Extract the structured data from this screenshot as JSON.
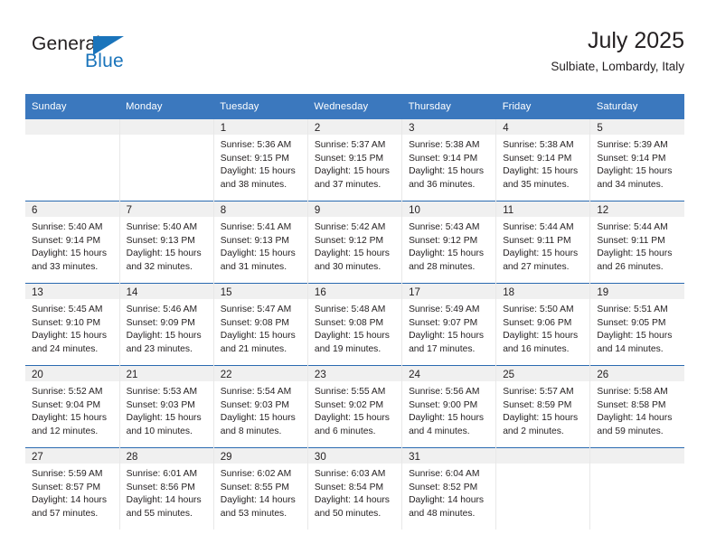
{
  "brand": {
    "word_top": "General",
    "word_bottom": "Blue",
    "accent_color": "#1a74bb"
  },
  "header": {
    "title": "July 2025",
    "subtitle": "Sulbiate, Lombardy, Italy"
  },
  "theme": {
    "header_bg": "#3b78be",
    "header_text": "#ffffff",
    "daynum_band_bg": "#f0f0f0",
    "row_divider": "#2a6ab0",
    "text": "#231f20"
  },
  "weekday_headers": [
    "Sunday",
    "Monday",
    "Tuesday",
    "Wednesday",
    "Thursday",
    "Friday",
    "Saturday"
  ],
  "weeks": [
    [
      {
        "day": "",
        "lines": []
      },
      {
        "day": "",
        "lines": []
      },
      {
        "day": "1",
        "lines": [
          "Sunrise: 5:36 AM",
          "Sunset: 9:15 PM",
          "Daylight: 15 hours",
          "and 38 minutes."
        ]
      },
      {
        "day": "2",
        "lines": [
          "Sunrise: 5:37 AM",
          "Sunset: 9:15 PM",
          "Daylight: 15 hours",
          "and 37 minutes."
        ]
      },
      {
        "day": "3",
        "lines": [
          "Sunrise: 5:38 AM",
          "Sunset: 9:14 PM",
          "Daylight: 15 hours",
          "and 36 minutes."
        ]
      },
      {
        "day": "4",
        "lines": [
          "Sunrise: 5:38 AM",
          "Sunset: 9:14 PM",
          "Daylight: 15 hours",
          "and 35 minutes."
        ]
      },
      {
        "day": "5",
        "lines": [
          "Sunrise: 5:39 AM",
          "Sunset: 9:14 PM",
          "Daylight: 15 hours",
          "and 34 minutes."
        ]
      }
    ],
    [
      {
        "day": "6",
        "lines": [
          "Sunrise: 5:40 AM",
          "Sunset: 9:14 PM",
          "Daylight: 15 hours",
          "and 33 minutes."
        ]
      },
      {
        "day": "7",
        "lines": [
          "Sunrise: 5:40 AM",
          "Sunset: 9:13 PM",
          "Daylight: 15 hours",
          "and 32 minutes."
        ]
      },
      {
        "day": "8",
        "lines": [
          "Sunrise: 5:41 AM",
          "Sunset: 9:13 PM",
          "Daylight: 15 hours",
          "and 31 minutes."
        ]
      },
      {
        "day": "9",
        "lines": [
          "Sunrise: 5:42 AM",
          "Sunset: 9:12 PM",
          "Daylight: 15 hours",
          "and 30 minutes."
        ]
      },
      {
        "day": "10",
        "lines": [
          "Sunrise: 5:43 AM",
          "Sunset: 9:12 PM",
          "Daylight: 15 hours",
          "and 28 minutes."
        ]
      },
      {
        "day": "11",
        "lines": [
          "Sunrise: 5:44 AM",
          "Sunset: 9:11 PM",
          "Daylight: 15 hours",
          "and 27 minutes."
        ]
      },
      {
        "day": "12",
        "lines": [
          "Sunrise: 5:44 AM",
          "Sunset: 9:11 PM",
          "Daylight: 15 hours",
          "and 26 minutes."
        ]
      }
    ],
    [
      {
        "day": "13",
        "lines": [
          "Sunrise: 5:45 AM",
          "Sunset: 9:10 PM",
          "Daylight: 15 hours",
          "and 24 minutes."
        ]
      },
      {
        "day": "14",
        "lines": [
          "Sunrise: 5:46 AM",
          "Sunset: 9:09 PM",
          "Daylight: 15 hours",
          "and 23 minutes."
        ]
      },
      {
        "day": "15",
        "lines": [
          "Sunrise: 5:47 AM",
          "Sunset: 9:08 PM",
          "Daylight: 15 hours",
          "and 21 minutes."
        ]
      },
      {
        "day": "16",
        "lines": [
          "Sunrise: 5:48 AM",
          "Sunset: 9:08 PM",
          "Daylight: 15 hours",
          "and 19 minutes."
        ]
      },
      {
        "day": "17",
        "lines": [
          "Sunrise: 5:49 AM",
          "Sunset: 9:07 PM",
          "Daylight: 15 hours",
          "and 17 minutes."
        ]
      },
      {
        "day": "18",
        "lines": [
          "Sunrise: 5:50 AM",
          "Sunset: 9:06 PM",
          "Daylight: 15 hours",
          "and 16 minutes."
        ]
      },
      {
        "day": "19",
        "lines": [
          "Sunrise: 5:51 AM",
          "Sunset: 9:05 PM",
          "Daylight: 15 hours",
          "and 14 minutes."
        ]
      }
    ],
    [
      {
        "day": "20",
        "lines": [
          "Sunrise: 5:52 AM",
          "Sunset: 9:04 PM",
          "Daylight: 15 hours",
          "and 12 minutes."
        ]
      },
      {
        "day": "21",
        "lines": [
          "Sunrise: 5:53 AM",
          "Sunset: 9:03 PM",
          "Daylight: 15 hours",
          "and 10 minutes."
        ]
      },
      {
        "day": "22",
        "lines": [
          "Sunrise: 5:54 AM",
          "Sunset: 9:03 PM",
          "Daylight: 15 hours",
          "and 8 minutes."
        ]
      },
      {
        "day": "23",
        "lines": [
          "Sunrise: 5:55 AM",
          "Sunset: 9:02 PM",
          "Daylight: 15 hours",
          "and 6 minutes."
        ]
      },
      {
        "day": "24",
        "lines": [
          "Sunrise: 5:56 AM",
          "Sunset: 9:00 PM",
          "Daylight: 15 hours",
          "and 4 minutes."
        ]
      },
      {
        "day": "25",
        "lines": [
          "Sunrise: 5:57 AM",
          "Sunset: 8:59 PM",
          "Daylight: 15 hours",
          "and 2 minutes."
        ]
      },
      {
        "day": "26",
        "lines": [
          "Sunrise: 5:58 AM",
          "Sunset: 8:58 PM",
          "Daylight: 14 hours",
          "and 59 minutes."
        ]
      }
    ],
    [
      {
        "day": "27",
        "lines": [
          "Sunrise: 5:59 AM",
          "Sunset: 8:57 PM",
          "Daylight: 14 hours",
          "and 57 minutes."
        ]
      },
      {
        "day": "28",
        "lines": [
          "Sunrise: 6:01 AM",
          "Sunset: 8:56 PM",
          "Daylight: 14 hours",
          "and 55 minutes."
        ]
      },
      {
        "day": "29",
        "lines": [
          "Sunrise: 6:02 AM",
          "Sunset: 8:55 PM",
          "Daylight: 14 hours",
          "and 53 minutes."
        ]
      },
      {
        "day": "30",
        "lines": [
          "Sunrise: 6:03 AM",
          "Sunset: 8:54 PM",
          "Daylight: 14 hours",
          "and 50 minutes."
        ]
      },
      {
        "day": "31",
        "lines": [
          "Sunrise: 6:04 AM",
          "Sunset: 8:52 PM",
          "Daylight: 14 hours",
          "and 48 minutes."
        ]
      },
      {
        "day": "",
        "lines": []
      },
      {
        "day": "",
        "lines": []
      }
    ]
  ]
}
